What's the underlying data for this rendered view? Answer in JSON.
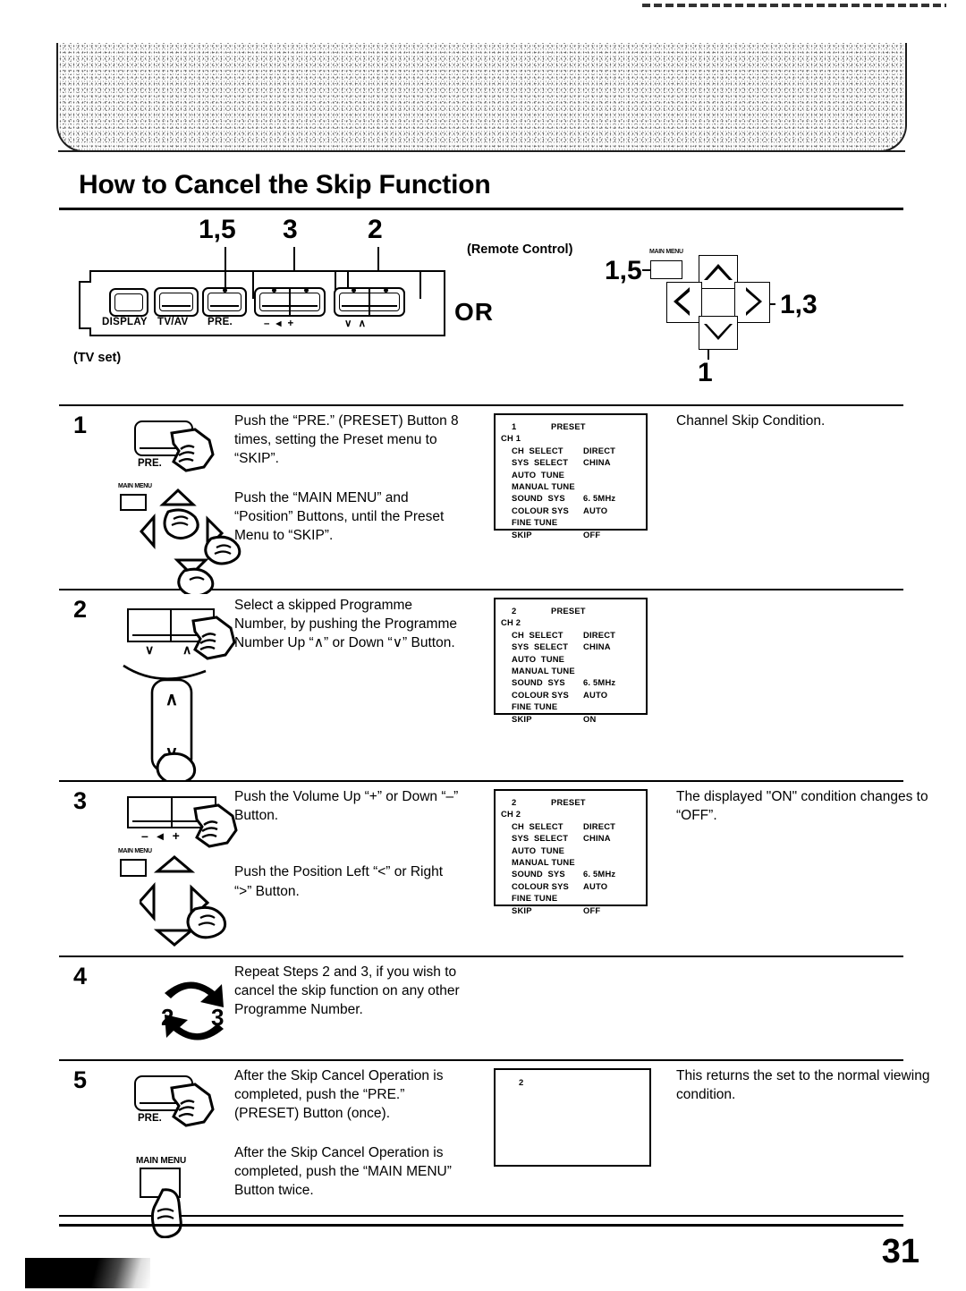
{
  "page": {
    "title": "How to Cancel the Skip Function",
    "number": "31"
  },
  "header_diagram": {
    "tv_set_caption": "(TV set)",
    "remote_caption": "(Remote Control)",
    "or_label": "OR",
    "tv_panel": {
      "callouts": [
        {
          "label": "1,5",
          "target": "pre-button"
        },
        {
          "label": "3",
          "target": "volume-buttons"
        },
        {
          "label": "2",
          "target": "programme-buttons"
        }
      ],
      "buttons": [
        {
          "name": "display-button",
          "label": "DISPLAY"
        },
        {
          "name": "tv-av-button",
          "label": "TV/AV"
        },
        {
          "name": "pre-button",
          "label": "PRE."
        },
        {
          "name": "volume-buttons",
          "label": "–  ◂  +"
        },
        {
          "name": "programme-buttons",
          "label": "∨      ∧"
        }
      ]
    },
    "remote": {
      "main_menu_label": "MAIN MENU",
      "callouts": [
        {
          "label": "1,5",
          "target": "main-menu-button"
        },
        {
          "label": "1,3",
          "target": "position-right-button"
        },
        {
          "label": "1",
          "target": "position-down-button"
        }
      ]
    }
  },
  "steps": [
    {
      "number": "1",
      "instructions": [
        "Push the “PRE.” (PRESET) Button 8 times, setting the Preset menu to “SKIP”.",
        "Push the “MAIN MENU” and “Position” Buttons, until the Preset Menu to “SKIP”."
      ],
      "device_labels": [
        "PRE.",
        "MAIN MENU"
      ],
      "screen": {
        "programme": "1",
        "title": "PRESET",
        "channel": "CH 1",
        "rows": [
          {
            "label": "CH  SELECT",
            "value": "DIRECT"
          },
          {
            "label": "SYS  SELECT",
            "value": "CHINA"
          },
          {
            "label": "AUTO  TUNE",
            "value": ""
          },
          {
            "label": "MANUAL TUNE",
            "value": ""
          },
          {
            "label": "SOUND  SYS",
            "value": "6. 5MHz"
          },
          {
            "label": "COLOUR SYS",
            "value": "AUTO"
          },
          {
            "label": "FINE TUNE",
            "value": ""
          },
          {
            "label": "SKIP",
            "value": "OFF"
          }
        ]
      },
      "result": "Channel Skip Condition."
    },
    {
      "number": "2",
      "instructions": [
        "Select a skipped Programme Number, by pushing the Programme Number Up “∧” or Down “∨” Button."
      ],
      "device_labels": [
        "∨",
        "∧"
      ],
      "screen": {
        "programme": "2",
        "title": "PRESET",
        "channel": "CH 2",
        "rows": [
          {
            "label": "CH  SELECT",
            "value": "DIRECT"
          },
          {
            "label": "SYS  SELECT",
            "value": "CHINA"
          },
          {
            "label": "AUTO  TUNE",
            "value": ""
          },
          {
            "label": "MANUAL TUNE",
            "value": ""
          },
          {
            "label": "SOUND  SYS",
            "value": "6. 5MHz"
          },
          {
            "label": "COLOUR SYS",
            "value": "AUTO"
          },
          {
            "label": "FINE TUNE",
            "value": ""
          },
          {
            "label": "SKIP",
            "value": "ON"
          }
        ]
      },
      "result": ""
    },
    {
      "number": "3",
      "instructions": [
        "Push the Volume Up “+” or Down “–” Button.",
        "Push the Position Left “<” or Right “>” Button."
      ],
      "device_labels": [
        "–  ◂  +",
        "MAIN MENU"
      ],
      "screen": {
        "programme": "2",
        "title": "PRESET",
        "channel": "CH 2",
        "rows": [
          {
            "label": "CH  SELECT",
            "value": "DIRECT"
          },
          {
            "label": "SYS  SELECT",
            "value": "CHINA"
          },
          {
            "label": "AUTO  TUNE",
            "value": ""
          },
          {
            "label": "MANUAL TUNE",
            "value": ""
          },
          {
            "label": "SOUND  SYS",
            "value": "6. 5MHz"
          },
          {
            "label": "COLOUR SYS",
            "value": "AUTO"
          },
          {
            "label": "FINE TUNE",
            "value": ""
          },
          {
            "label": "SKIP",
            "value": "OFF"
          }
        ]
      },
      "result": "The displayed \"ON\" condition changes to “OFF”."
    },
    {
      "number": "4",
      "instructions": [
        "Repeat Steps 2 and 3, if you wish to cancel the skip function on any other Programme Number."
      ],
      "cycle_labels": [
        "2",
        "3"
      ],
      "result": ""
    },
    {
      "number": "5",
      "instructions": [
        "After the Skip Cancel Operation is completed, push the “PRE.” (PRESET) Button (once).",
        "After the Skip Cancel Operation is completed, push the “MAIN MENU” Button twice."
      ],
      "device_labels": [
        "PRE.",
        "MAIN MENU"
      ],
      "screen_blank": {
        "programme": "2"
      },
      "result": "This returns the set to the normal viewing condition."
    }
  ]
}
